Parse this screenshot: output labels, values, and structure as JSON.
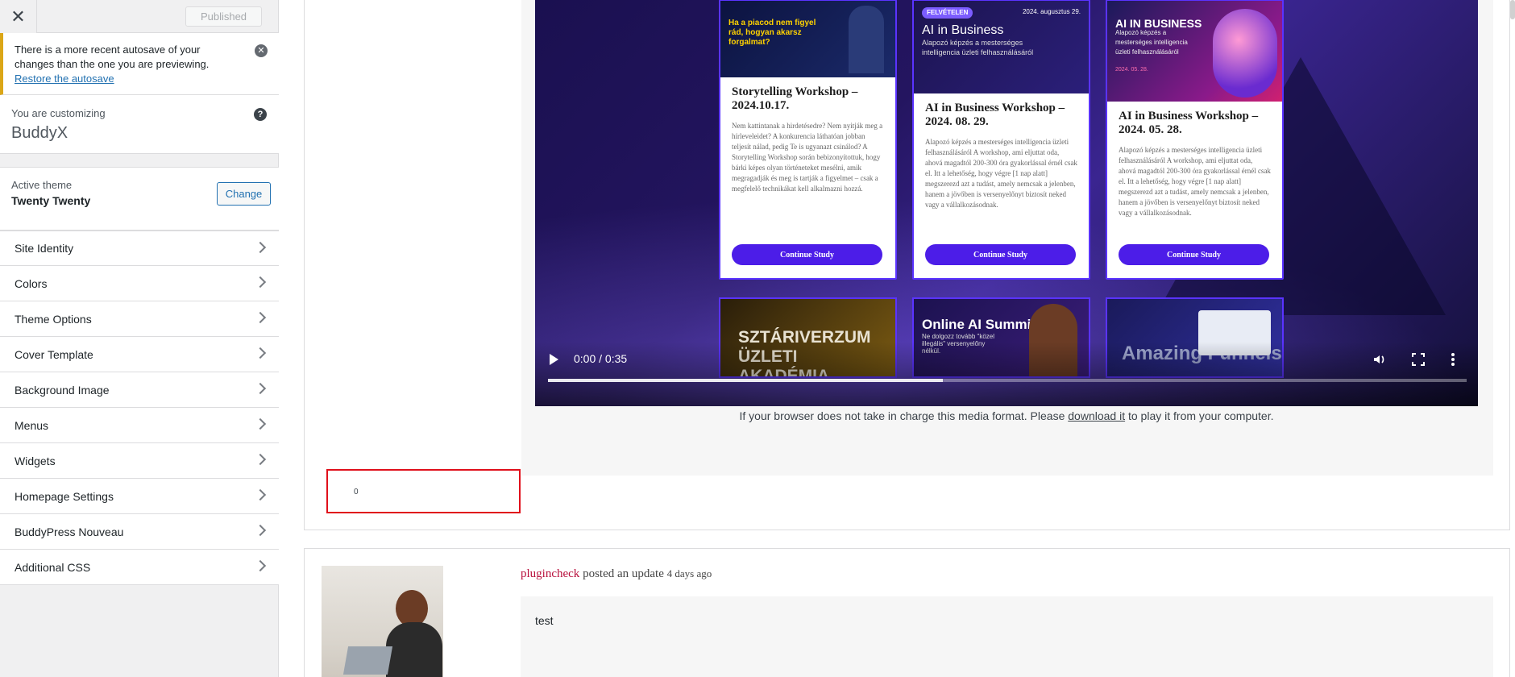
{
  "sidebar": {
    "close_icon": "close-icon",
    "publish_label": "Published",
    "autosave": {
      "text": "There is a more recent autosave of your changes than the one you are previewing.",
      "link": "Restore the autosave"
    },
    "customizing_label": "You are customizing",
    "site_name": "BuddyX",
    "active_theme_label": "Active theme",
    "active_theme_name": "Twenty Twenty",
    "change_label": "Change",
    "items": [
      {
        "label": "Site Identity"
      },
      {
        "label": "Colors"
      },
      {
        "label": "Theme Options"
      },
      {
        "label": "Cover Template"
      },
      {
        "label": "Background Image"
      },
      {
        "label": "Menus"
      },
      {
        "label": "Widgets"
      },
      {
        "label": "Homepage Settings"
      },
      {
        "label": "BuddyPress Nouveau"
      },
      {
        "label": "Additional CSS"
      }
    ]
  },
  "preview": {
    "video": {
      "cards": [
        {
          "image_text": "Ha a piacod nem figyel rád, hogyan akarsz forgalmat?",
          "title": "Storytelling Workshop – 2024.10.17.",
          "desc": "Nem kattintanak a hirdetésedre? Nem nyitják meg a hírleveleidet? A konkurencia láthatóan jobban teljesít nálad, pedig Te is ugyanazt csinálod? A Storytelling Workshop során bebizonyítottuk, hogy bárki képes olyan történeteket mesélni, amik megragadják és meg is tartják a figyelmet – csak a megfelelő technikákat kell alkalmazni hozzá.",
          "button": "Continue Study"
        },
        {
          "image_text": "AI in Business",
          "image_sub": "Alapozó képzés a mesterséges intelligencia üzleti felhasználásáról",
          "image_badge": "FELVÉTELEN",
          "image_date": "2024. augusztus 29.",
          "title": "AI in Business Workshop – 2024. 08. 29.",
          "desc": "Alapozó képzés a mesterséges intelligencia üzleti felhasználásáról A workshop, ami eljuttat oda, ahová magadtól 200-300 óra gyakorlással érnél csak el. Itt a lehetőség, hogy végre [1 nap alatt] megszerezd azt a tudást, amely nemcsak a jelenben, hanem a jövőben is versenyelőnyt biztosít neked vagy a vállalkozásodnak.",
          "button": "Continue Study"
        },
        {
          "image_text": "AI IN BUSINESS",
          "image_sub": "Alapozó képzés a mesterséges intelligencia üzleti felhasználásáról",
          "image_date": "2024. 05. 28.",
          "title": "AI in Business Workshop – 2024. 05. 28.",
          "desc": "Alapozó képzés a mesterséges intelligencia üzleti felhasználásáról A workshop, ami eljuttat oda, ahová magadtól 200-300 óra gyakorlással érnél csak el. Itt a lehetőség, hogy végre [1 nap alatt] megszerezd azt a tudást, amely nemcsak a jelenben, hanem a jövőben is versenyelőnyt biztosít neked vagy a vállalkozásodnak.",
          "button": "Continue Study"
        }
      ],
      "row2": [
        {
          "text": "SZTÁRIVERZUM ÜZLETI AKADÉMIA"
        },
        {
          "text": "Online AI Summit",
          "sub": "Ne dolgozz tovább \"közel illegális\" versenyelőny nélkül."
        },
        {
          "text": "Amazing Funnels"
        }
      ],
      "time": "0:00 / 0:35",
      "progress": 0.43,
      "play_icon": "play-icon",
      "volume_icon": "volume-icon",
      "fullscreen_icon": "fullscreen-icon",
      "more_icon": "more-vertical-icon"
    },
    "fallback": {
      "before": "If your browser does not take in charge this media format. Please ",
      "link": "download it",
      "after": " to play it from your computer."
    },
    "highlight_value": "0",
    "post": {
      "user": "plugincheck",
      "action": " posted an update ",
      "ago": "4 days ago",
      "body": "test"
    },
    "highlight_color": "#e0101b",
    "accent": "#4c1de8"
  }
}
